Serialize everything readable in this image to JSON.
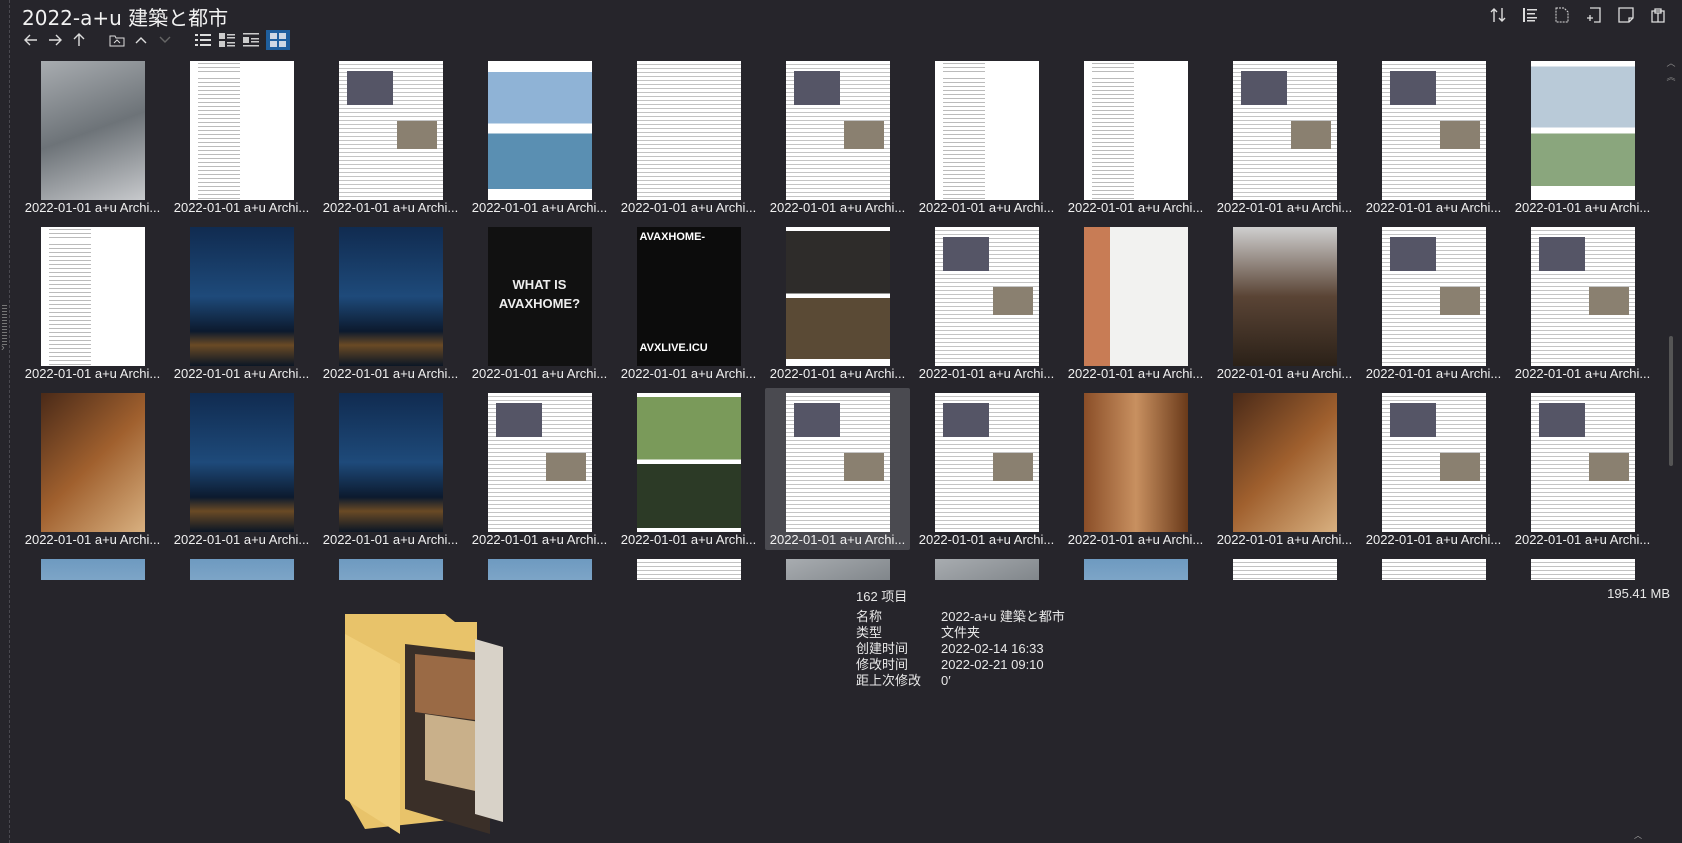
{
  "window": {
    "title": "2022-a+u 建築と都市"
  },
  "toolbar": {
    "nav": [
      "back-icon",
      "forward-icon",
      "up-icon",
      "folder-icon",
      "chevron-up-icon",
      "chevron-down-icon",
      "list-view-icon",
      "details-view-icon",
      "tiles-view-icon",
      "thumbnails-view-icon"
    ],
    "actions": [
      "sort-icon",
      "properties-icon",
      "new-file-icon",
      "new-item-icon",
      "note-icon",
      "clipboard-icon"
    ]
  },
  "grid": {
    "tile_label": "2022-01-01 a+u Archi...",
    "labeled_count": 33,
    "selected_index": 27,
    "avax": {
      "what_is": "WHAT IS",
      "name": "AVAXHOME?",
      "header": "AVAXHOME-",
      "footer": "AVXLIVE.ICU"
    }
  },
  "details": {
    "item_count": "162 项目",
    "total_size": "195.41 MB",
    "properties": [
      {
        "key": "名称",
        "value": "2022-a+u 建築と都市"
      },
      {
        "key": "类型",
        "value": "文件夹"
      },
      {
        "key": "创建时间",
        "value": "2022-02-14  16:33"
      },
      {
        "key": "修改时间",
        "value": "2022-02-21  09:10"
      },
      {
        "key": "距上次修改",
        "value": "0′"
      }
    ]
  },
  "colors": {
    "background": "#26252b",
    "accent": "#1f5f9e",
    "selected_tile": "#4a4a50"
  }
}
